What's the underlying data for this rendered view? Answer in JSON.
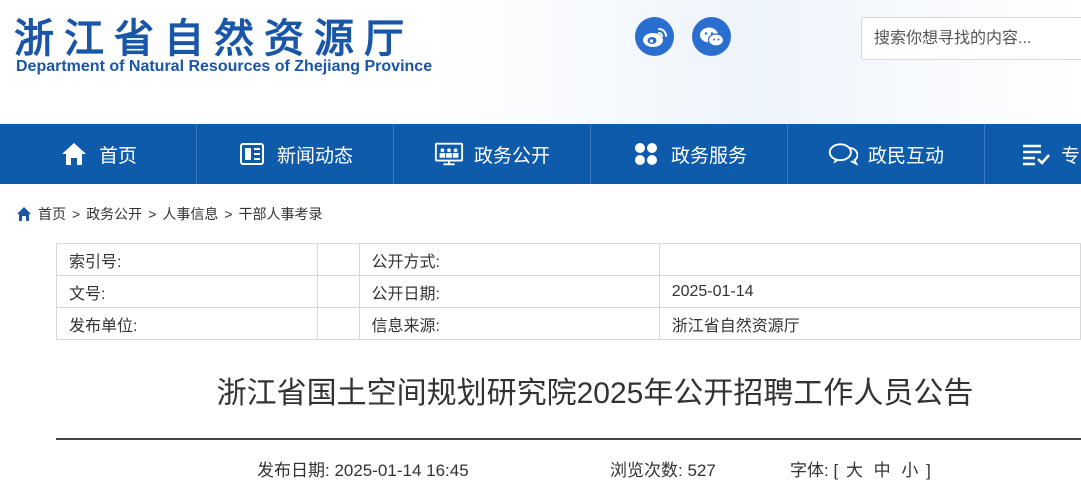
{
  "header": {
    "title_cn": "浙江省自然资源厅",
    "title_en": "Department of Natural Resources of Zhejiang Province",
    "search_placeholder": "搜索你想寻找的内容...",
    "weibo_icon": "weibo-icon",
    "wechat_icon": "wechat-icon",
    "brand_color": "#1a56a8"
  },
  "nav": {
    "bg_color": "#0f5bab",
    "items": [
      {
        "label": "首页",
        "icon": "home-icon"
      },
      {
        "label": "新闻动态",
        "icon": "news-icon"
      },
      {
        "label": "政务公开",
        "icon": "gov-open-icon"
      },
      {
        "label": "政务服务",
        "icon": "services-icon"
      },
      {
        "label": "政民互动",
        "icon": "chat-icon"
      },
      {
        "label": "专",
        "icon": "list-check-icon"
      }
    ]
  },
  "breadcrumb": {
    "items": [
      "首页",
      "政务公开",
      "人事信息",
      "干部人事考录"
    ],
    "separator": ">"
  },
  "info": {
    "rows": [
      {
        "label1": "索引号:",
        "value1": "",
        "label2": "公开方式:",
        "value2": ""
      },
      {
        "label1": "文号:",
        "value1": "",
        "label2": "公开日期:",
        "value2": "2025-01-14"
      },
      {
        "label1": "发布单位:",
        "value1": "",
        "label2": "信息来源:",
        "value2": "浙江省自然资源厅"
      }
    ]
  },
  "article": {
    "title": "浙江省国土空间规划研究院2025年公开招聘工作人员公告",
    "publish_date": "发布日期: 2025-01-14 16:45",
    "views": "浏览次数: 527",
    "font_label": "字体:",
    "font_open": "[",
    "font_large": "大",
    "font_medium": "中",
    "font_small": "小",
    "font_close": "]"
  }
}
